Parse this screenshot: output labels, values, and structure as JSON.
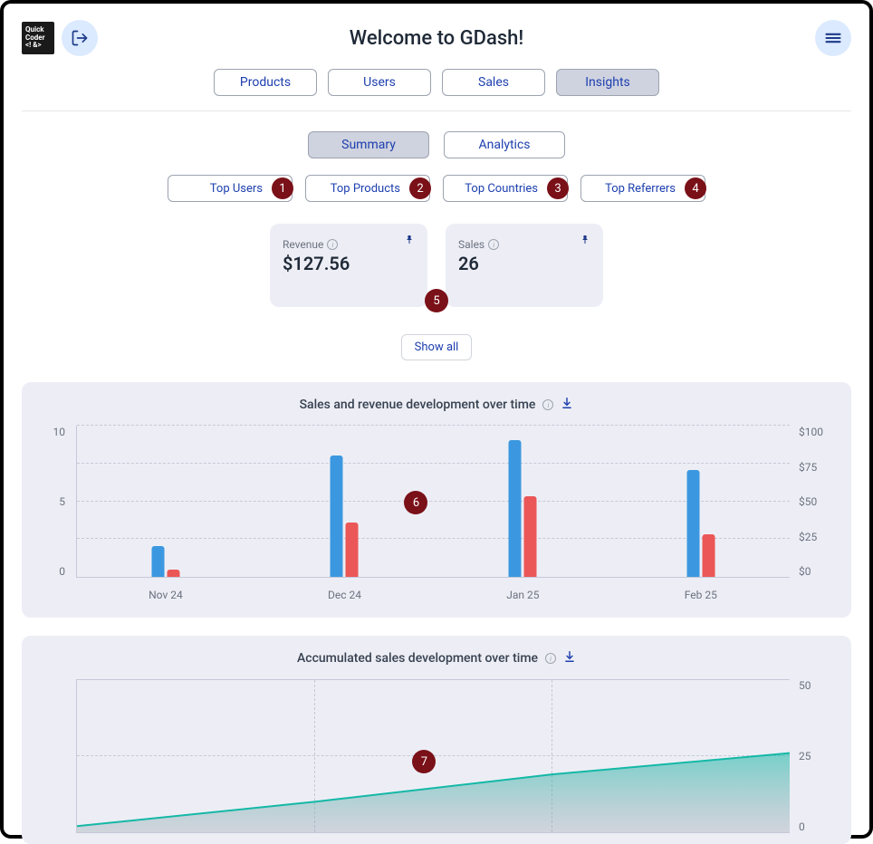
{
  "header": {
    "title": "Welcome to GDash!",
    "logo_lines": [
      "Quick",
      "Coder",
      "<! &>"
    ]
  },
  "tabs": {
    "items": [
      "Products",
      "Users",
      "Sales",
      "Insights"
    ],
    "active": 3
  },
  "subtabs": {
    "items": [
      "Summary",
      "Analytics"
    ],
    "active": 0
  },
  "top_chips": [
    {
      "label": "Top Users",
      "badge": "1"
    },
    {
      "label": "Top Products",
      "badge": "2"
    },
    {
      "label": "Top Countries",
      "badge": "3"
    },
    {
      "label": "Top Referrers",
      "badge": "4"
    }
  ],
  "cards": [
    {
      "label": "Revenue",
      "value": "$127.56"
    },
    {
      "label": "Sales",
      "value": "26"
    }
  ],
  "center_badge": "5",
  "show_all": "Show all",
  "chart1": {
    "title": "Sales and revenue development over time",
    "badge": "6"
  },
  "chart2": {
    "title": "Accumulated sales development over time",
    "badge": "7"
  },
  "chart_data": [
    {
      "type": "bar",
      "title": "Sales and revenue development over time",
      "categories": [
        "Nov 24",
        "Dec 24",
        "Jan 25",
        "Feb 25"
      ],
      "series": [
        {
          "name": "Sales",
          "values": [
            2,
            8,
            9,
            7
          ],
          "axis": "left",
          "color": "#3b98e0"
        },
        {
          "name": "Revenue",
          "values": [
            5,
            36,
            53,
            28
          ],
          "axis": "right",
          "color": "#eb5757"
        }
      ],
      "y_left": {
        "label": "",
        "ticks": [
          0,
          5,
          10
        ],
        "range": [
          0,
          10
        ]
      },
      "y_right": {
        "label": "",
        "ticks": [
          "$0",
          "$25",
          "$50",
          "$75",
          "$100"
        ],
        "range": [
          0,
          100
        ]
      }
    },
    {
      "type": "area",
      "title": "Accumulated sales development over time",
      "x": [
        0,
        1,
        2,
        3
      ],
      "values": [
        2,
        10,
        19,
        26
      ],
      "y_right": {
        "ticks": [
          0,
          25,
          50
        ],
        "range": [
          0,
          50
        ]
      },
      "color_line": "#14b8a6",
      "color_fill_start": "#14b8a6",
      "color_fill_end": "#9ca3af"
    }
  ]
}
